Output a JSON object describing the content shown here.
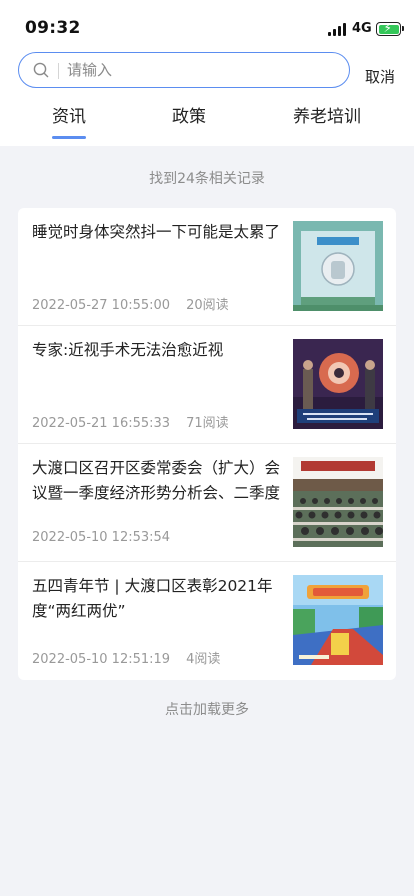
{
  "status_bar": {
    "time": "09:32",
    "network": "4G"
  },
  "search": {
    "placeholder": "请输入",
    "value": "",
    "cancel_label": "取消"
  },
  "tabs": [
    {
      "label": "资讯",
      "active": true
    },
    {
      "label": "政策",
      "active": false
    },
    {
      "label": "养老培训",
      "active": false
    }
  ],
  "result_count": "找到24条相关记录",
  "articles": [
    {
      "title": "睡觉时身体突然抖一下可能是太累了",
      "date": "2022-05-27 10:55:00",
      "reads": "20阅读"
    },
    {
      "title": "专家:近视手术无法治愈近视",
      "date": "2022-05-21 16:55:33",
      "reads": "71阅读"
    },
    {
      "title": "大渡口区召开区委常委会（扩大）会议暨一季度经济形势分析会、二季度",
      "date": "2022-05-10 12:53:54",
      "reads": ""
    },
    {
      "title": "五四青年节 | 大渡口区表彰2021年度“两红两优”",
      "date": "2022-05-10 12:51:19",
      "reads": "4阅读"
    }
  ],
  "load_more": "点击加载更多",
  "colors": {
    "accent": "#5b8df0",
    "page_bg": "#f2f3f7",
    "battery": "#34c759"
  }
}
